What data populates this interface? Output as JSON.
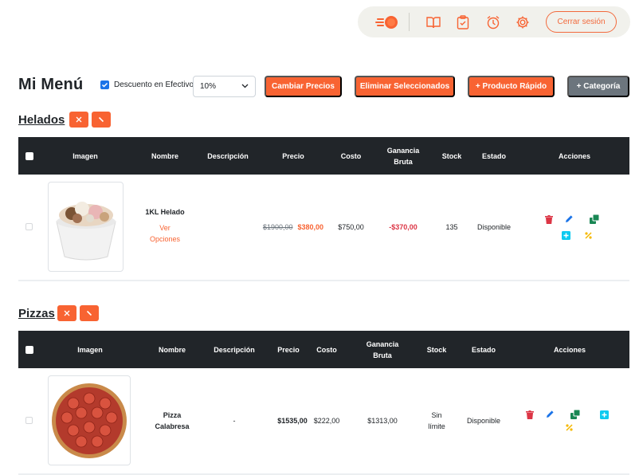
{
  "nav": {
    "logout_label": "Cerrar sesión",
    "icons": [
      "brand-logo-icon",
      "book-icon",
      "clipboard-check-icon",
      "alarm-clock-icon",
      "gear-icon"
    ]
  },
  "page_title": "Mi Menú",
  "toolbar": {
    "discount_label": "Descuento en Efectivo",
    "discount_checked": true,
    "discount_value": "10%",
    "change_prices_label": "Cambiar Precios",
    "delete_selected_label": "Eliminar Seleccionados",
    "quick_product_label": "+ Producto Rápido",
    "add_category_label": "+ Categoría"
  },
  "columns": {
    "image": "Imagen",
    "name": "Nombre",
    "description": "Descripción",
    "price": "Precio",
    "cost": "Costo",
    "gross_profit_line1": "Ganancia",
    "gross_profit_line2": "Bruta",
    "stock": "Stock",
    "status": "Estado",
    "actions": "Acciones"
  },
  "categories": [
    {
      "name": "Helados",
      "products": [
        {
          "name": "1KL Helado",
          "options_line1": "Ver",
          "options_line2": "Opciones",
          "description": "",
          "old_price": "$1900,00",
          "price": "$380,00",
          "cost": "$750,00",
          "gross_profit": "-$370,00",
          "stock": "135",
          "status": "Disponible"
        }
      ]
    },
    {
      "name": "Pizzas",
      "products": [
        {
          "name_line1": "Pizza",
          "name_line2": "Calabresa",
          "description": "-",
          "price": "$1535,00",
          "cost": "$222,00",
          "gross_profit": "$1313,00",
          "stock_line1": "Sin",
          "stock_line2": "límite",
          "status": "Disponible"
        }
      ]
    }
  ],
  "colors": {
    "accent": "#f86332",
    "header_bg": "#212529",
    "delete": "#dc3545",
    "edit": "#1a73e8",
    "copy": "#198754",
    "add": "#0dcaf0",
    "discount": "#f5b800"
  }
}
